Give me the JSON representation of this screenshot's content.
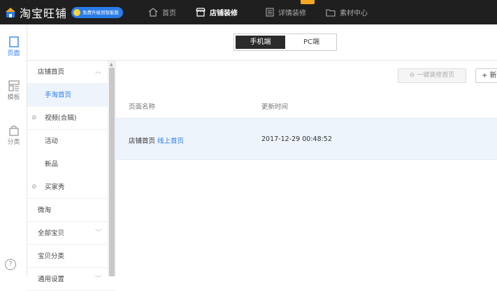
{
  "app": {
    "name": "淘宝旺铺",
    "upgrade_badge": "免费升级到智能版"
  },
  "topnav": [
    {
      "label": "首页",
      "icon": "home-icon"
    },
    {
      "label": "店铺装修",
      "icon": "store-icon",
      "active": true
    },
    {
      "label": "详情装修",
      "icon": "document-icon"
    },
    {
      "label": "素材中心",
      "icon": "folder-icon"
    }
  ],
  "rail": [
    {
      "label": "页面",
      "icon": "page-icon",
      "active": true
    },
    {
      "label": "模板",
      "icon": "template-icon"
    },
    {
      "label": "分类",
      "icon": "bag-icon"
    }
  ],
  "help": "?",
  "toggle": {
    "mobile": "手机端",
    "pc": "PC端"
  },
  "sidebar": {
    "items": [
      {
        "label": "店铺首页"
      },
      {
        "label": "手淘首页"
      },
      {
        "label": "视频(合辑)"
      },
      {
        "label": "活动"
      },
      {
        "label": "新品"
      },
      {
        "label": "买家秀"
      },
      {
        "label": "微淘"
      },
      {
        "label": "全部宝贝"
      },
      {
        "label": "宝贝分类"
      },
      {
        "label": "通用设置"
      }
    ]
  },
  "actions": {
    "one_key": "一键装修首页",
    "new": "+ 新"
  },
  "table": {
    "headers": {
      "name": "页面名称",
      "updated": "更新时间"
    },
    "rows": [
      {
        "name": "店铺首页",
        "tag": "线上首页",
        "updated": "2017-12-29 00:48:52"
      }
    ]
  }
}
